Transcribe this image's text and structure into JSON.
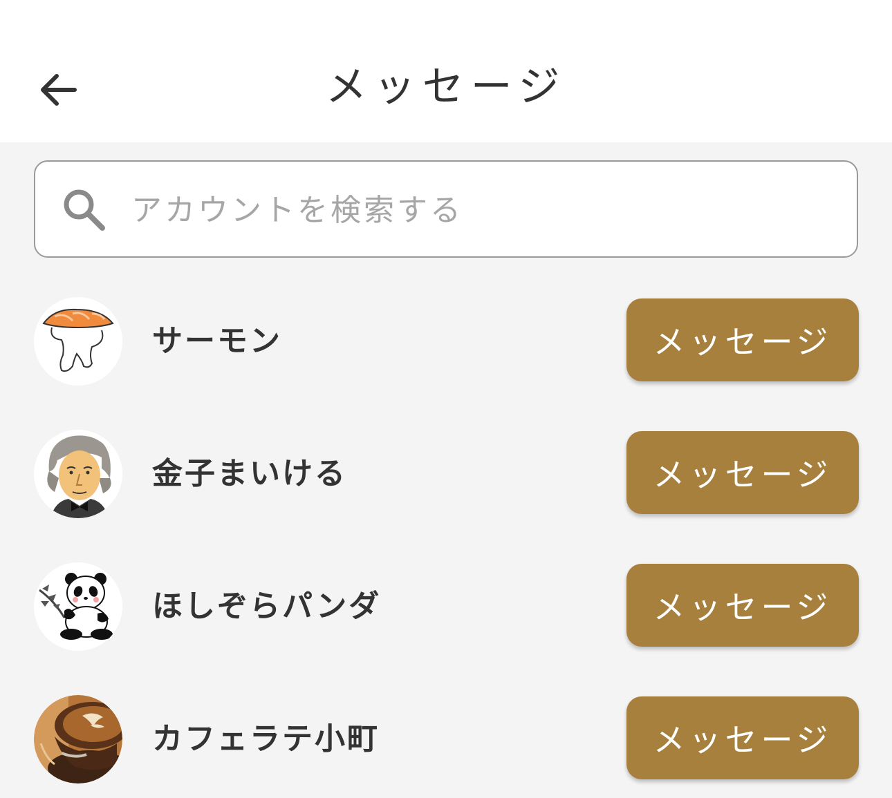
{
  "header": {
    "title": "メッセージ",
    "back_icon": "arrow-left-icon"
  },
  "search": {
    "placeholder": "アカウントを検索する",
    "value": "",
    "icon": "search-icon"
  },
  "accounts": [
    {
      "name": "サーモン",
      "avatar": "salmon-sushi-avatar",
      "button_label": "メッセージ"
    },
    {
      "name": "金子まいける",
      "avatar": "portrait-man-avatar",
      "button_label": "メッセージ"
    },
    {
      "name": "ほしぞらパンダ",
      "avatar": "panda-avatar",
      "button_label": "メッセージ"
    },
    {
      "name": "カフェラテ小町",
      "avatar": "cafe-latte-avatar",
      "button_label": "メッセージ"
    }
  ],
  "colors": {
    "accent_button": "#a8803e",
    "background": "#f4f4f4",
    "header_background": "#ffffff",
    "text": "#333333",
    "placeholder": "#a6a6a6"
  }
}
